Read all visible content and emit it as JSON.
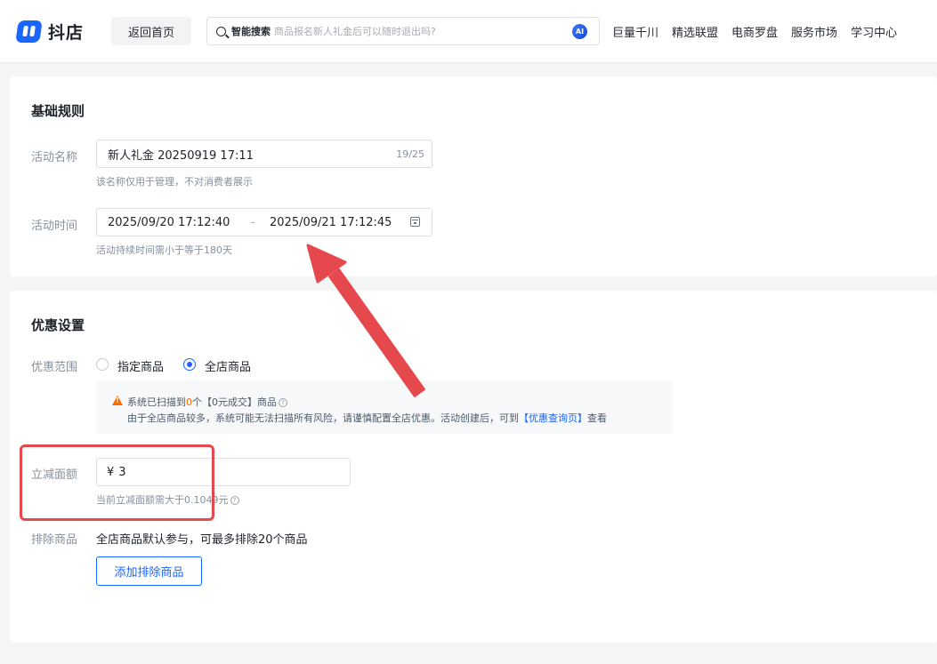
{
  "header": {
    "brand": "抖店",
    "home_button": "返回首页",
    "search": {
      "label": "智能搜索",
      "placeholder": "商品报名新人礼金后可以随时退出吗?",
      "ai_badge": "AI"
    },
    "nav": [
      "巨量千川",
      "精选联盟",
      "电商罗盘",
      "服务市场",
      "学习中心"
    ]
  },
  "basic_rules": {
    "title": "基础规则",
    "name": {
      "label": "活动名称",
      "value": "新人礼金 20250919 17:11",
      "counter": "19/25",
      "hint": "该名称仅用于管理，不对消费者展示"
    },
    "time": {
      "label": "活动时间",
      "start": "2025/09/20 17:12:40",
      "separator": "-",
      "end": "2025/09/21 17:12:45",
      "hint": "活动持续时间需小于等于180天"
    }
  },
  "discount": {
    "title": "优惠设置",
    "scope": {
      "label": "优惠范围",
      "options": [
        {
          "label": "指定商品",
          "checked": false
        },
        {
          "label": "全店商品",
          "checked": true
        }
      ]
    },
    "alert": {
      "line1_prefix": "系统已扫描到",
      "line1_count": "0",
      "line1_suffix": "个【0元成交】商品",
      "line2_prefix": "由于全店商品较多，系统可能无法扫描所有风险，请谨慎配置全店优惠。活动创建后，可到",
      "line2_link": "【优惠查询页】",
      "line2_suffix": "查看"
    },
    "amount": {
      "label": "立减面额",
      "currency": "¥",
      "value": "3",
      "hint": "当前立减面额需大于0.1049元"
    },
    "exclude": {
      "label": "排除商品",
      "text": "全店商品默认参与，可最多排除20个商品",
      "button": "添加排除商品"
    }
  },
  "colors": {
    "brand": "#1966ff",
    "warning": "#ff6a00",
    "annotation": "#e5484d"
  }
}
